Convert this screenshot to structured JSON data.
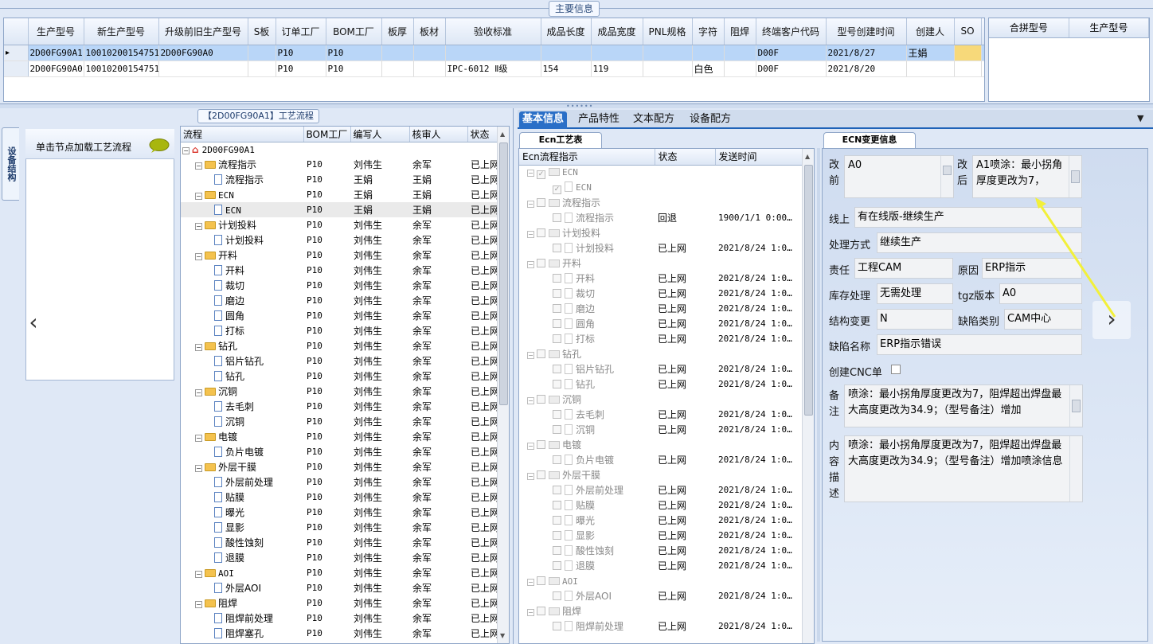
{
  "main_info": {
    "title": "主要信息",
    "columns": [
      "生产型号",
      "新生产型号",
      "升级前旧生产型号",
      "S板",
      "订单工厂",
      "BOM工厂",
      "板厚",
      "板材",
      "验收标准",
      "成品长度",
      "成品宽度",
      "PNL规格",
      "字符",
      "阻焊",
      "终端客户代码",
      "型号创建时间",
      "创建人",
      "SO"
    ],
    "rows": [
      [
        "2D00FG90A1",
        "10010200154751",
        "2D00FG90A0",
        "",
        "P10",
        "P10",
        "",
        "",
        "",
        "",
        "",
        "",
        "",
        "",
        "D00F",
        "2021/8/27",
        "王娟",
        ""
      ],
      [
        "2D00FG90A0",
        "10010200154751",
        "",
        "",
        "P10",
        "P10",
        "",
        "",
        "IPC-6012 Ⅱ级",
        "154",
        "119",
        "",
        "白色",
        "",
        "D00F",
        "2021/8/20",
        "",
        ""
      ]
    ],
    "row_indicator": "▸"
  },
  "combine_grid": {
    "columns": [
      "合拼型号",
      "生产型号"
    ]
  },
  "left": {
    "vertical_tab": "设备结构",
    "load_hint": "单击节点加载工艺流程"
  },
  "process": {
    "title": "【2D00FG90A1】工艺流程",
    "columns": [
      "流程",
      "BOM工厂",
      "编写人",
      "核审人",
      "状态"
    ],
    "rows": [
      {
        "level": 0,
        "type": "root",
        "name": "2D00FG90A1",
        "bom": "",
        "writer": "",
        "reviewer": "",
        "status": ""
      },
      {
        "level": 1,
        "type": "folder",
        "name": "流程指示",
        "bom": "P10",
        "writer": "刘伟生",
        "reviewer": "余军",
        "status": "已上网"
      },
      {
        "level": 2,
        "type": "doc",
        "name": "流程指示",
        "bom": "P10",
        "writer": "王娟",
        "reviewer": "王娟",
        "status": "已上网"
      },
      {
        "level": 1,
        "type": "folder",
        "name": "ECN",
        "bom": "P10",
        "writer": "王娟",
        "reviewer": "王娟",
        "status": "已上网"
      },
      {
        "level": 2,
        "type": "doc",
        "name": "ECN",
        "bom": "P10",
        "writer": "王娟",
        "reviewer": "王娟",
        "status": "已上网",
        "selected": true
      },
      {
        "level": 1,
        "type": "folder",
        "name": "计划投料",
        "bom": "P10",
        "writer": "刘伟生",
        "reviewer": "余军",
        "status": "已上网"
      },
      {
        "level": 2,
        "type": "doc",
        "name": "计划投料",
        "bom": "P10",
        "writer": "刘伟生",
        "reviewer": "余军",
        "status": "已上网"
      },
      {
        "level": 1,
        "type": "folder",
        "name": "开料",
        "bom": "P10",
        "writer": "刘伟生",
        "reviewer": "余军",
        "status": "已上网"
      },
      {
        "level": 2,
        "type": "doc",
        "name": "开料",
        "bom": "P10",
        "writer": "刘伟生",
        "reviewer": "余军",
        "status": "已上网"
      },
      {
        "level": 2,
        "type": "doc",
        "name": "裁切",
        "bom": "P10",
        "writer": "刘伟生",
        "reviewer": "余军",
        "status": "已上网"
      },
      {
        "level": 2,
        "type": "doc",
        "name": "磨边",
        "bom": "P10",
        "writer": "刘伟生",
        "reviewer": "余军",
        "status": "已上网"
      },
      {
        "level": 2,
        "type": "doc",
        "name": "圆角",
        "bom": "P10",
        "writer": "刘伟生",
        "reviewer": "余军",
        "status": "已上网"
      },
      {
        "level": 2,
        "type": "doc",
        "name": "打标",
        "bom": "P10",
        "writer": "刘伟生",
        "reviewer": "余军",
        "status": "已上网"
      },
      {
        "level": 1,
        "type": "folder",
        "name": "钻孔",
        "bom": "P10",
        "writer": "刘伟生",
        "reviewer": "余军",
        "status": "已上网"
      },
      {
        "level": 2,
        "type": "doc",
        "name": "铝片钻孔",
        "bom": "P10",
        "writer": "刘伟生",
        "reviewer": "余军",
        "status": "已上网"
      },
      {
        "level": 2,
        "type": "doc",
        "name": "钻孔",
        "bom": "P10",
        "writer": "刘伟生",
        "reviewer": "余军",
        "status": "已上网"
      },
      {
        "level": 1,
        "type": "folder",
        "name": "沉铜",
        "bom": "P10",
        "writer": "刘伟生",
        "reviewer": "余军",
        "status": "已上网"
      },
      {
        "level": 2,
        "type": "doc",
        "name": "去毛刺",
        "bom": "P10",
        "writer": "刘伟生",
        "reviewer": "余军",
        "status": "已上网"
      },
      {
        "level": 2,
        "type": "doc",
        "name": "沉铜",
        "bom": "P10",
        "writer": "刘伟生",
        "reviewer": "余军",
        "status": "已上网"
      },
      {
        "level": 1,
        "type": "folder",
        "name": "电镀",
        "bom": "P10",
        "writer": "刘伟生",
        "reviewer": "余军",
        "status": "已上网"
      },
      {
        "level": 2,
        "type": "doc",
        "name": "负片电镀",
        "bom": "P10",
        "writer": "刘伟生",
        "reviewer": "余军",
        "status": "已上网"
      },
      {
        "level": 1,
        "type": "folder",
        "name": "外层干膜",
        "bom": "P10",
        "writer": "刘伟生",
        "reviewer": "余军",
        "status": "已上网"
      },
      {
        "level": 2,
        "type": "doc",
        "name": "外层前处理",
        "bom": "P10",
        "writer": "刘伟生",
        "reviewer": "余军",
        "status": "已上网"
      },
      {
        "level": 2,
        "type": "doc",
        "name": "贴膜",
        "bom": "P10",
        "writer": "刘伟生",
        "reviewer": "余军",
        "status": "已上网"
      },
      {
        "level": 2,
        "type": "doc",
        "name": "曝光",
        "bom": "P10",
        "writer": "刘伟生",
        "reviewer": "余军",
        "status": "已上网"
      },
      {
        "level": 2,
        "type": "doc",
        "name": "显影",
        "bom": "P10",
        "writer": "刘伟生",
        "reviewer": "余军",
        "status": "已上网"
      },
      {
        "level": 2,
        "type": "doc",
        "name": "酸性蚀刻",
        "bom": "P10",
        "writer": "刘伟生",
        "reviewer": "余军",
        "status": "已上网"
      },
      {
        "level": 2,
        "type": "doc",
        "name": "退膜",
        "bom": "P10",
        "writer": "刘伟生",
        "reviewer": "余军",
        "status": "已上网"
      },
      {
        "level": 1,
        "type": "folder",
        "name": "AOI",
        "bom": "P10",
        "writer": "刘伟生",
        "reviewer": "余军",
        "status": "已上网"
      },
      {
        "level": 2,
        "type": "doc",
        "name": "外层AOI",
        "bom": "P10",
        "writer": "刘伟生",
        "reviewer": "余军",
        "status": "已上网"
      },
      {
        "level": 1,
        "type": "folder",
        "name": "阻焊",
        "bom": "P10",
        "writer": "刘伟生",
        "reviewer": "余军",
        "status": "已上网"
      },
      {
        "level": 2,
        "type": "doc",
        "name": "阻焊前处理",
        "bom": "P10",
        "writer": "刘伟生",
        "reviewer": "余军",
        "status": "已上网"
      },
      {
        "level": 2,
        "type": "doc",
        "name": "阻焊塞孔",
        "bom": "P10",
        "writer": "刘伟生",
        "reviewer": "余军",
        "status": "已上网"
      }
    ]
  },
  "tabs": [
    "基本信息",
    "产品特性",
    "文本配方",
    "设备配方"
  ],
  "ecn_table": {
    "tab_label": "Ecn工艺表",
    "columns": [
      "Ecn流程指示",
      "状态",
      "发送时间"
    ],
    "rows": [
      {
        "level": 1,
        "type": "folder",
        "name": "ECN",
        "status": "",
        "time": "",
        "checked": true
      },
      {
        "level": 2,
        "type": "doc",
        "name": "ECN",
        "status": "",
        "time": "",
        "checked": true
      },
      {
        "level": 1,
        "type": "folder",
        "name": "流程指示",
        "status": "",
        "time": ""
      },
      {
        "level": 2,
        "type": "doc",
        "name": "流程指示",
        "status": "回退",
        "time": "1900/1/1 0:00…"
      },
      {
        "level": 1,
        "type": "folder",
        "name": "计划投料",
        "status": "",
        "time": ""
      },
      {
        "level": 2,
        "type": "doc",
        "name": "计划投料",
        "status": "已上网",
        "time": "2021/8/24 1:0…"
      },
      {
        "level": 1,
        "type": "folder",
        "name": "开料",
        "status": "",
        "time": ""
      },
      {
        "level": 2,
        "type": "doc",
        "name": "开料",
        "status": "已上网",
        "time": "2021/8/24 1:0…"
      },
      {
        "level": 2,
        "type": "doc",
        "name": "裁切",
        "status": "已上网",
        "time": "2021/8/24 1:0…"
      },
      {
        "level": 2,
        "type": "doc",
        "name": "磨边",
        "status": "已上网",
        "time": "2021/8/24 1:0…"
      },
      {
        "level": 2,
        "type": "doc",
        "name": "圆角",
        "status": "已上网",
        "time": "2021/8/24 1:0…"
      },
      {
        "level": 2,
        "type": "doc",
        "name": "打标",
        "status": "已上网",
        "time": "2021/8/24 1:0…"
      },
      {
        "level": 1,
        "type": "folder",
        "name": "钻孔",
        "status": "",
        "time": ""
      },
      {
        "level": 2,
        "type": "doc",
        "name": "铝片钻孔",
        "status": "已上网",
        "time": "2021/8/24 1:0…"
      },
      {
        "level": 2,
        "type": "doc",
        "name": "钻孔",
        "status": "已上网",
        "time": "2021/8/24 1:0…"
      },
      {
        "level": 1,
        "type": "folder",
        "name": "沉铜",
        "status": "",
        "time": ""
      },
      {
        "level": 2,
        "type": "doc",
        "name": "去毛刺",
        "status": "已上网",
        "time": "2021/8/24 1:0…"
      },
      {
        "level": 2,
        "type": "doc",
        "name": "沉铜",
        "status": "已上网",
        "time": "2021/8/24 1:0…"
      },
      {
        "level": 1,
        "type": "folder",
        "name": "电镀",
        "status": "",
        "time": ""
      },
      {
        "level": 2,
        "type": "doc",
        "name": "负片电镀",
        "status": "已上网",
        "time": "2021/8/24 1:0…"
      },
      {
        "level": 1,
        "type": "folder",
        "name": "外层干膜",
        "status": "",
        "time": ""
      },
      {
        "level": 2,
        "type": "doc",
        "name": "外层前处理",
        "status": "已上网",
        "time": "2021/8/24 1:0…"
      },
      {
        "level": 2,
        "type": "doc",
        "name": "贴膜",
        "status": "已上网",
        "time": "2021/8/24 1:0…"
      },
      {
        "level": 2,
        "type": "doc",
        "name": "曝光",
        "status": "已上网",
        "time": "2021/8/24 1:0…"
      },
      {
        "level": 2,
        "type": "doc",
        "name": "显影",
        "status": "已上网",
        "time": "2021/8/24 1:0…"
      },
      {
        "level": 2,
        "type": "doc",
        "name": "酸性蚀刻",
        "status": "已上网",
        "time": "2021/8/24 1:0…"
      },
      {
        "level": 2,
        "type": "doc",
        "name": "退膜",
        "status": "已上网",
        "time": "2021/8/24 1:0…"
      },
      {
        "level": 1,
        "type": "folder",
        "name": "AOI",
        "status": "",
        "time": ""
      },
      {
        "level": 2,
        "type": "doc",
        "name": "外层AOI",
        "status": "已上网",
        "time": "2021/8/24 1:0…"
      },
      {
        "level": 1,
        "type": "folder",
        "name": "阻焊",
        "status": "",
        "time": ""
      },
      {
        "level": 2,
        "type": "doc",
        "name": "阻焊前处理",
        "status": "已上网",
        "time": "2021/8/24 1:0…"
      }
    ]
  },
  "ecn_change": {
    "tab_label": "ECN变更信息",
    "before_label": "改前",
    "before_value": "A0",
    "after_label": "改后",
    "after_value": "A1喷涂：最小拐角厚度更改为7，",
    "online_label": "线上",
    "online_value": "有在线版-继续生产",
    "handling_label": "处理方式",
    "handling_value": "继续生产",
    "resp_label": "责任",
    "resp_value": "工程CAM",
    "reason_label": "原因",
    "reason_value": "ERP指示",
    "stock_label": "库存处理",
    "stock_value": "无需处理",
    "tgz_label": "tgz版本",
    "tgz_value": "A0",
    "struct_label": "结构变更",
    "struct_value": "N",
    "defect_type_label": "缺陷类别",
    "defect_type_value": "CAM中心",
    "defect_name_label": "缺陷名称",
    "defect_name_value": "ERP指示错误",
    "cnc_label": "创建CNC单",
    "remark_label": "备注",
    "remark_value": "喷涂：最小拐角厚度更改为7，阻焊超出焊盘最大高度更改为34.9；（型号备注）增加",
    "desc_label": "内容描述",
    "desc_value": "喷涂：最小拐角厚度更改为7，阻焊超出焊盘最大高度更改为34.9；（型号备注）增加喷涂信息"
  },
  "colors": {
    "accent": "#2a6fc7",
    "selection": "#b9d6f8",
    "panel": "#dfe8f6",
    "annotation": "#f2f03a"
  }
}
